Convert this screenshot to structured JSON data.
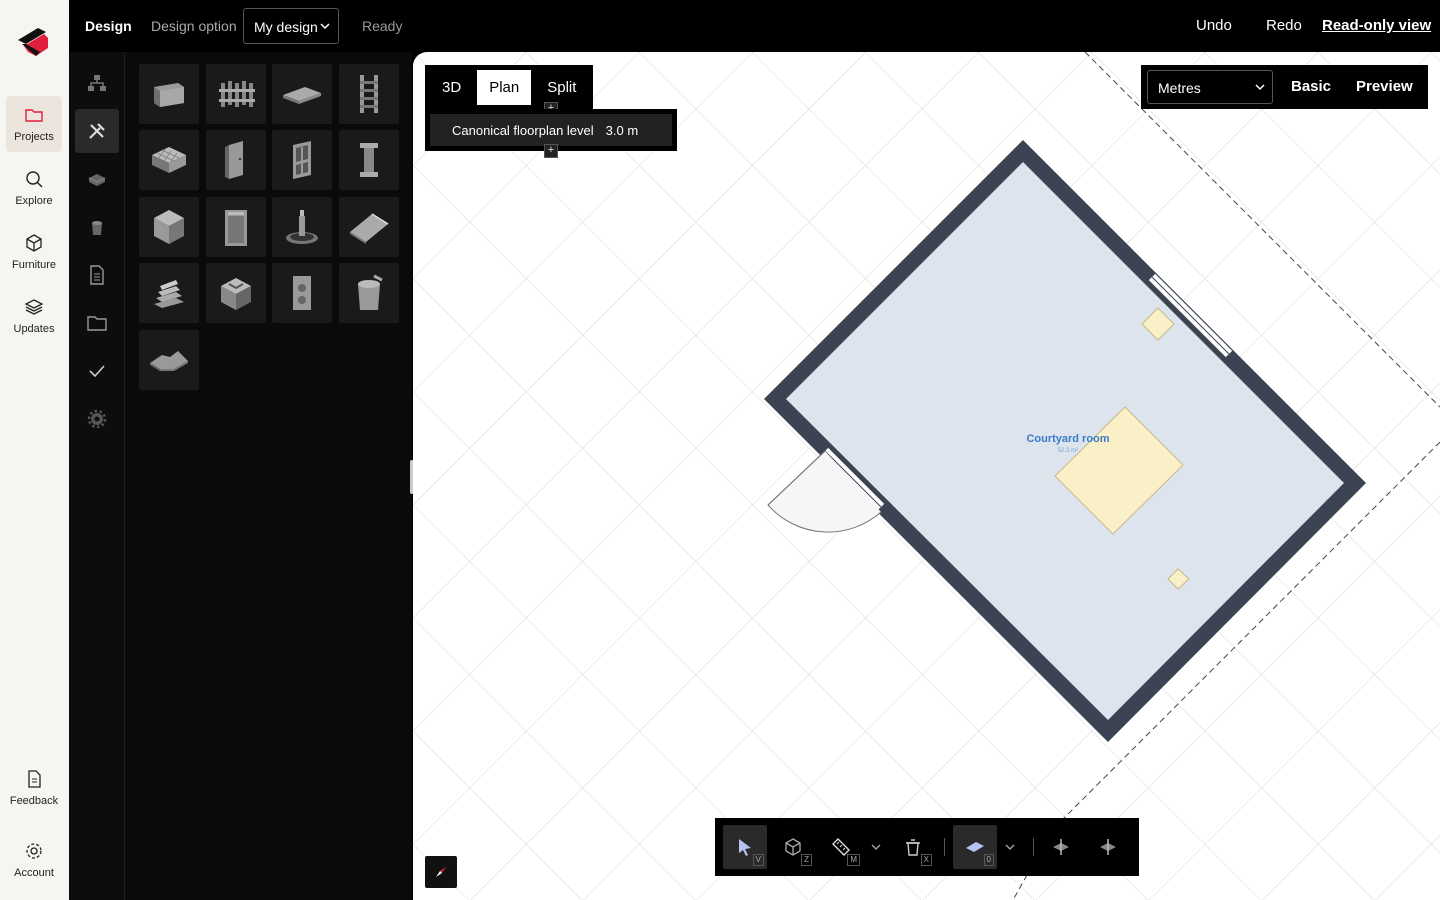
{
  "rail": {
    "items": [
      {
        "label": "Projects",
        "icon": "folder-icon",
        "active": true
      },
      {
        "label": "Explore",
        "icon": "search-icon"
      },
      {
        "label": "Furniture",
        "icon": "cube-icon"
      },
      {
        "label": "Updates",
        "icon": "layers-icon"
      }
    ],
    "feedback": "Feedback",
    "account": "Account"
  },
  "topbar": {
    "tab": "Design",
    "option_label": "Design option",
    "option_value": "My design",
    "status": "Ready",
    "undo": "Undo",
    "redo": "Redo",
    "readonly": "Read-only view"
  },
  "views": {
    "items": [
      "3D",
      "Plan",
      "Split"
    ],
    "active": "Plan"
  },
  "level": {
    "name": "Canonical floorplan level",
    "height": "3.0 m"
  },
  "units": {
    "selected": "Metres",
    "basic": "Basic",
    "preview": "Preview"
  },
  "room": {
    "label": "Courtyard room",
    "area": "52.3 m²"
  },
  "toolbar_keys": {
    "select": "V",
    "orbit": "Z",
    "measure": "M",
    "delete": "X",
    "floors": "0"
  },
  "colors": {
    "room_fill": "#dde4ee",
    "wall": "#3c4453",
    "furniture": "#faf0c8",
    "accent": "#e0203c"
  }
}
